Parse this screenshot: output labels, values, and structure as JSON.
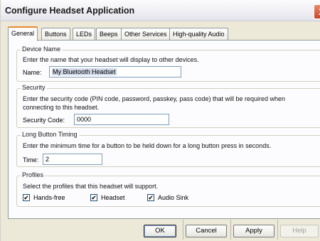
{
  "window": {
    "title": "Configure Headset Application",
    "close_glyph": "X"
  },
  "tabs": [
    {
      "label": "General",
      "active": true
    },
    {
      "label": "Buttons",
      "active": false
    },
    {
      "label": "LEDs",
      "active": false
    },
    {
      "label": "Beeps",
      "active": false
    },
    {
      "label": "Other Services",
      "active": false
    },
    {
      "label": "High-quality Audio",
      "active": false
    }
  ],
  "device_name": {
    "title": "Device Name",
    "description": "Enter the name that your headset will display to other devices.",
    "field_label": "Name:",
    "value": "My Bluetooth Headset"
  },
  "security": {
    "title": "Security",
    "description_line1": "Enter the security code (PIN code, password, passkey, pass code) that will be required when",
    "description_line2": "connecting to this headset.",
    "field_label": "Security Code:",
    "value": "0000"
  },
  "long_button": {
    "title": "Long Button Timing",
    "description": "Enter the minimum time for a button to be held down for a long button press in seconds.",
    "field_label": "Time:",
    "value": "2"
  },
  "profiles": {
    "title": "Profiles",
    "description": "Select the profiles that this headset will support.",
    "check_glyph": "✔",
    "items": [
      {
        "label": "Hands-free",
        "checked": true
      },
      {
        "label": "Headset",
        "checked": true
      },
      {
        "label": "Audio Sink",
        "checked": true
      }
    ]
  },
  "buttons": {
    "ok": "OK",
    "cancel": "Cancel",
    "apply": "Apply",
    "help": "Help"
  }
}
